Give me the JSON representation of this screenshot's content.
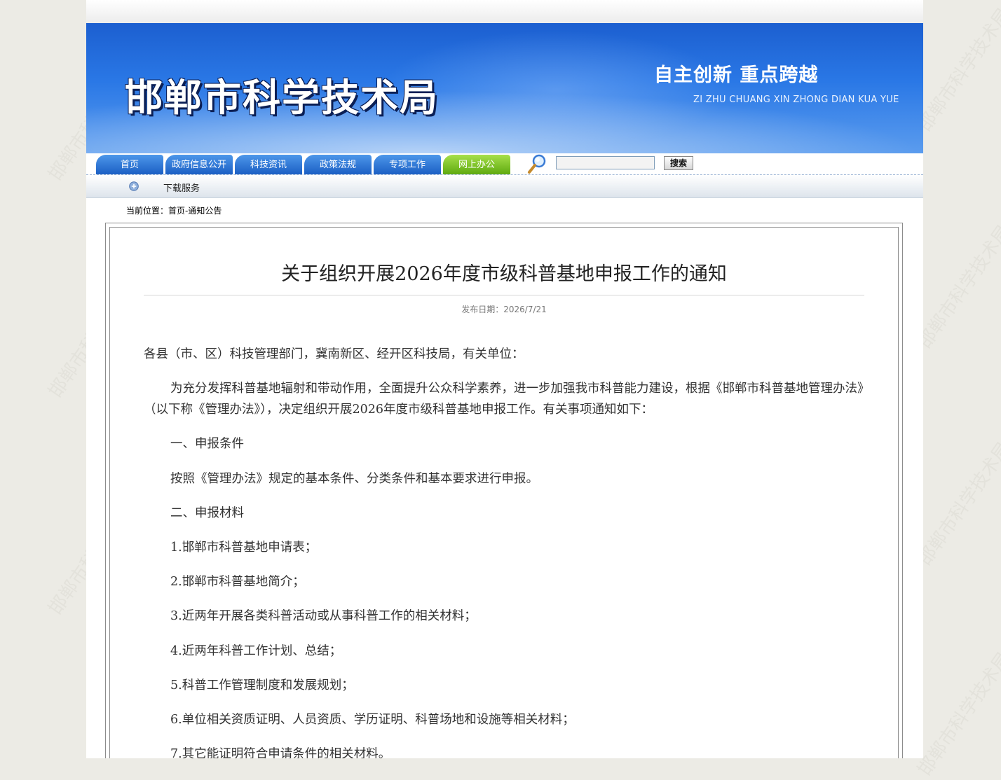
{
  "header": {
    "site_title": "邯郸市科学技术局",
    "slogan": "自主创新  重点跨越",
    "slogan_pinyin": "ZI ZHU CHUANG XIN ZHONG DIAN KUA YUE",
    "watermark": "邯郸市科学技术局"
  },
  "nav": {
    "tabs": [
      {
        "label": "首页"
      },
      {
        "label": "政府信息公开"
      },
      {
        "label": "科技资讯"
      },
      {
        "label": "政策法规"
      },
      {
        "label": "专项工作"
      },
      {
        "label": "网上办公"
      }
    ],
    "search_value": "",
    "search_button": "搜索"
  },
  "subnav": {
    "link": "下载服务"
  },
  "breadcrumb": "当前位置：首页-通知公告",
  "article": {
    "title": "关于组织开展2026年度市级科普基地申报工作的通知",
    "date": "发布日期：2026/7/21",
    "paragraphs": [
      "各县（市、区）科技管理部门，冀南新区、经开区科技局，有关单位：",
      "为充分发挥科普基地辐射和带动作用，全面提升公众科学素养，进一步加强我市科普能力建设，根据《邯郸市科普基地管理办法》（以下称《管理办法》），决定组织开展2026年度市级科普基地申报工作。有关事项通知如下：",
      "一、申报条件",
      "按照《管理办法》规定的基本条件、分类条件和基本要求进行申报。",
      "二、申报材料",
      "1.邯郸市科普基地申请表；",
      "2.邯郸市科普基地简介；",
      "3.近两年开展各类科普活动或从事科普工作的相关材料；",
      "4.近两年科普工作计划、总结；",
      "5.科普工作管理制度和发展规划；",
      "6.单位相关资质证明、人员资质、学历证明、科普场地和设施等相关材料；",
      "7.其它能证明符合申请条件的相关材料。"
    ]
  }
}
